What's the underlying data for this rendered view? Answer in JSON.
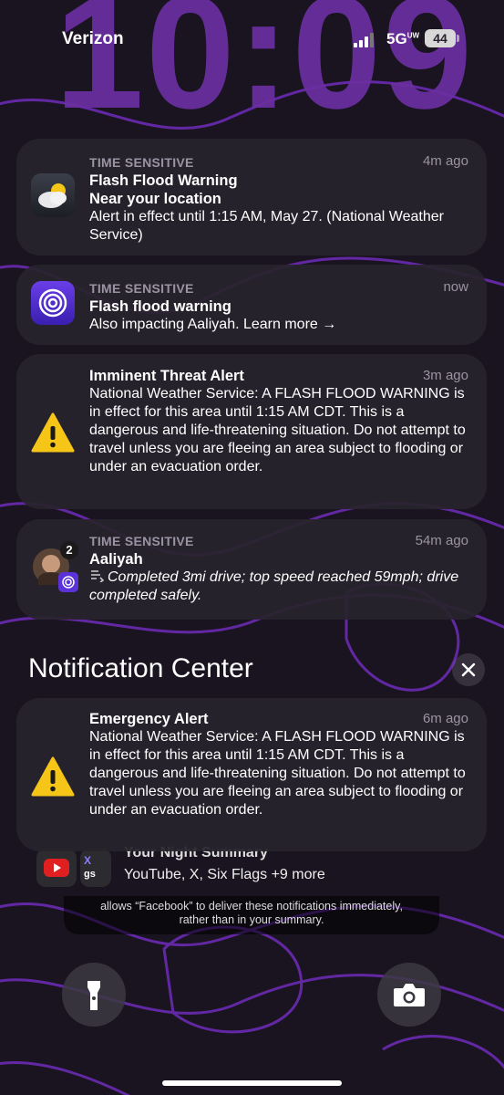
{
  "status_bar": {
    "carrier": "Verizon",
    "network": "5G",
    "network_suffix": "UW",
    "battery": "44"
  },
  "lock_clock": "10:09",
  "notifications": [
    {
      "label": "TIME SENSITIVE",
      "title": "Flash Flood Warning",
      "subtitle": "Near your location",
      "body": "Alert in effect until 1:15 AM, May 27. (National Weather Service)",
      "time": "4m ago",
      "icon": "weather-partly-cloudy-icon"
    },
    {
      "label": "TIME SENSITIVE",
      "title": "Flash flood warning",
      "body": "Also impacting Aaliyah. Learn more →",
      "time": "now",
      "icon": "life360-icon"
    },
    {
      "title": "Imminent Threat Alert",
      "body": "National Weather Service: A FLASH FLOOD WARNING is in effect for this area until 1:15 AM CDT. This is a dangerous and life-threatening situation. Do not attempt to travel unless you are fleeing an area subject to flooding or under an evacuation order.",
      "time": "3m ago",
      "icon": "warning-triangle-icon"
    },
    {
      "label": "TIME SENSITIVE",
      "title": "Aaliyah",
      "body": "Completed 3mi drive; top speed reached 59mph; drive completed safely.",
      "time": "54m ago",
      "badge": "2",
      "icon": "avatar-with-app-icon"
    }
  ],
  "notification_center": {
    "title": "Notification Center",
    "close": "×"
  },
  "emergency": {
    "title": "Emergency Alert",
    "body": "National Weather Service: A FLASH FLOOD WARNING is in effect for this area until 1:15 AM CDT. This is a dangerous and life-threatening situation. Do not attempt to travel unless you are fleeing an area subject to flooding or under an evacuation order.",
    "time": "6m ago",
    "icon": "warning-triangle-icon"
  },
  "summary": {
    "title": "Your Night Summary",
    "body": "YouTube, X, Six Flags +9 more",
    "partial_app_label": "gs"
  },
  "facebook_note": {
    "line1": "allows “Facebook” to deliver these notifications immediately,",
    "line2": "rather than in your summary."
  },
  "colors": {
    "background": "#1a1420",
    "contour": "#7b2fd0",
    "clock": "#6b2fa0",
    "card": "#28242c",
    "warning": "#f5c518",
    "youtube": "#e02020"
  }
}
